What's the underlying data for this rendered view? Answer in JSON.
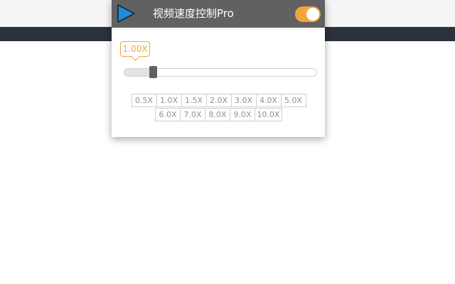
{
  "popup": {
    "title": "视频速度控制Pro",
    "enabled": true
  },
  "speed": {
    "label": "1.00X",
    "value": 1.0,
    "min": 0.5,
    "max": 10.0
  },
  "presets": [
    "0.5X",
    "1.0X",
    "1.5X",
    "2.0X",
    "3.0X",
    "4.0X",
    "5.0X",
    "6.0X",
    "7.0X",
    "8.0X",
    "9.0X",
    "10.0X"
  ],
  "colors": {
    "accent": "#f0a63c",
    "header": "#616161",
    "site_bar": "#2c323b"
  }
}
